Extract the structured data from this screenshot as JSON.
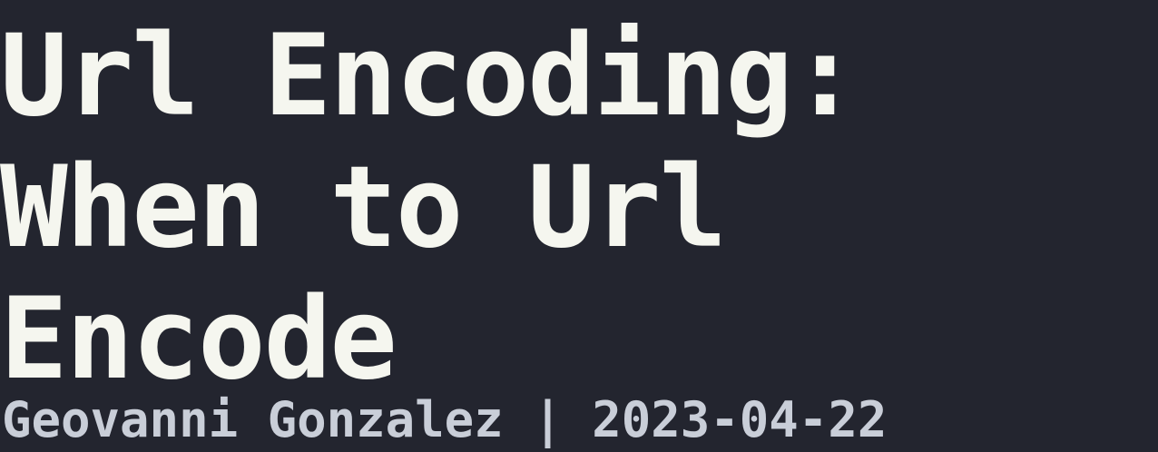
{
  "post": {
    "title_lines": [
      "Url Encoding:",
      "When to Url",
      "Encode"
    ],
    "author": "Geovanni Gonzalez",
    "separator": " | ",
    "date": "2023-04-22"
  },
  "colors": {
    "background": "#23252f",
    "title": "#f5f6ef",
    "byline": "#c9ced8"
  }
}
